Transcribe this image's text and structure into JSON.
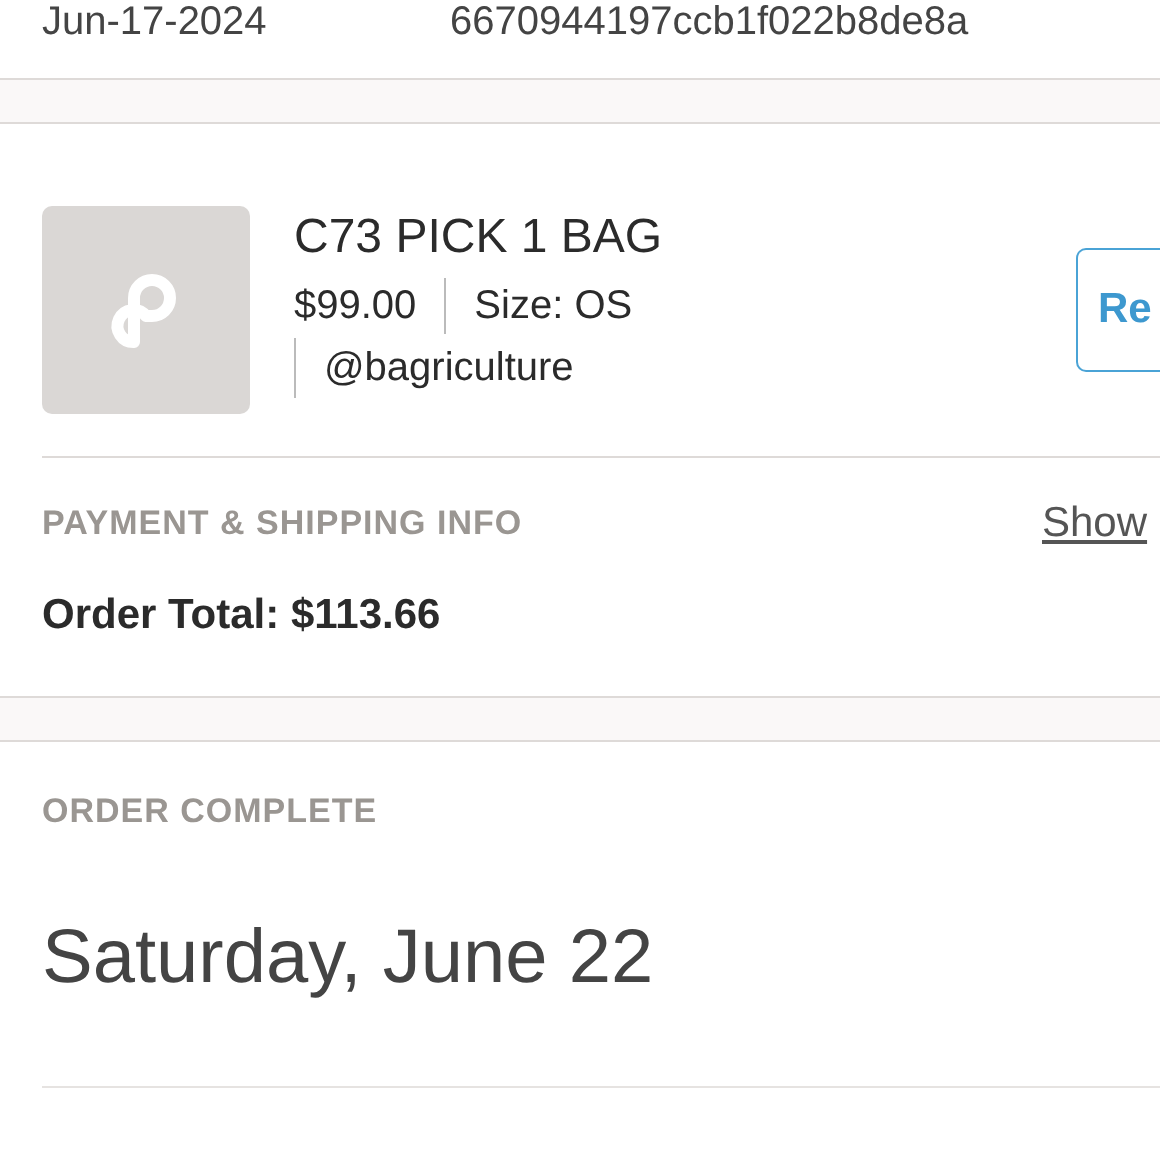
{
  "order_info": {
    "date": "Jun-17-2024",
    "order_id": "6670944197ccb1f022b8de8a"
  },
  "item": {
    "title": "C73 PICK 1 BAG",
    "price": "$99.00",
    "size": "Size: OS",
    "seller": "@bagriculture",
    "button": "Re"
  },
  "payment": {
    "heading": "PAYMENT & SHIPPING INFO",
    "link": "Show",
    "total_label": "Order Total:",
    "total": "$113.66"
  },
  "status": {
    "heading": "ORDER COMPLETE",
    "date": "Saturday, June 22"
  }
}
